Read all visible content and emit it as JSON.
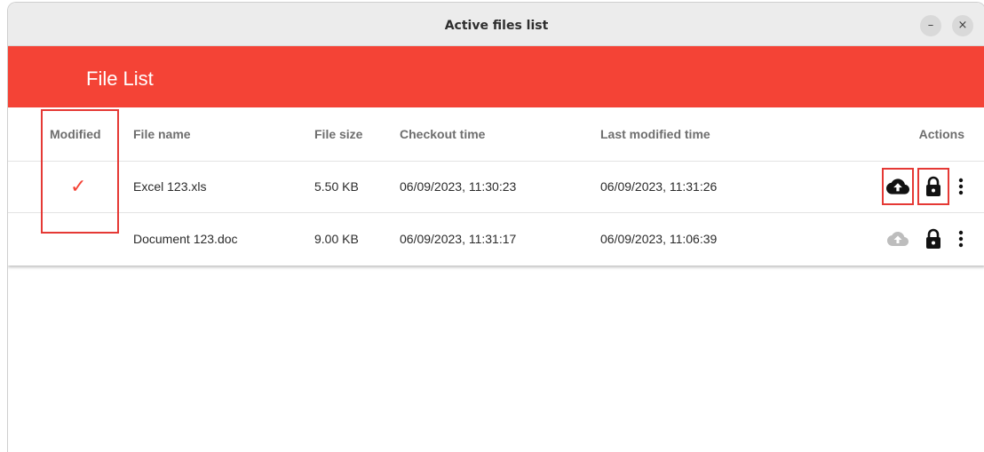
{
  "window": {
    "title": "Active files list",
    "minimize_label": "–",
    "close_label": "×"
  },
  "app": {
    "title": "File List"
  },
  "table": {
    "columns": {
      "modified": "Modified",
      "file_name": "File name",
      "file_size": "File size",
      "checkout_time": "Checkout time",
      "last_modified_time": "Last modified time",
      "actions": "Actions"
    },
    "rows": [
      {
        "modified_mark": "✓",
        "file_name": "Excel 123.xls",
        "file_size": "5.50 KB",
        "checkout_time": "06/09/2023, 11:30:23",
        "last_modified_time": "06/09/2023, 11:31:26",
        "upload_icon": "cloud-upload-icon",
        "upload_enabled": true,
        "lock_icon": "lock-icon",
        "more_icon": "more-vertical-icon"
      },
      {
        "modified_mark": "",
        "file_name": "Document 123.doc",
        "file_size": "9.00 KB",
        "checkout_time": "06/09/2023, 11:31:17",
        "last_modified_time": "06/09/2023, 11:06:39",
        "upload_icon": "cloud-upload-icon",
        "upload_enabled": false,
        "lock_icon": "lock-icon",
        "more_icon": "more-vertical-icon"
      }
    ]
  },
  "colors": {
    "accent": "#f44336",
    "highlight_box": "#e53935",
    "icon_active": "#111111",
    "icon_disabled": "#bdbdbd"
  }
}
